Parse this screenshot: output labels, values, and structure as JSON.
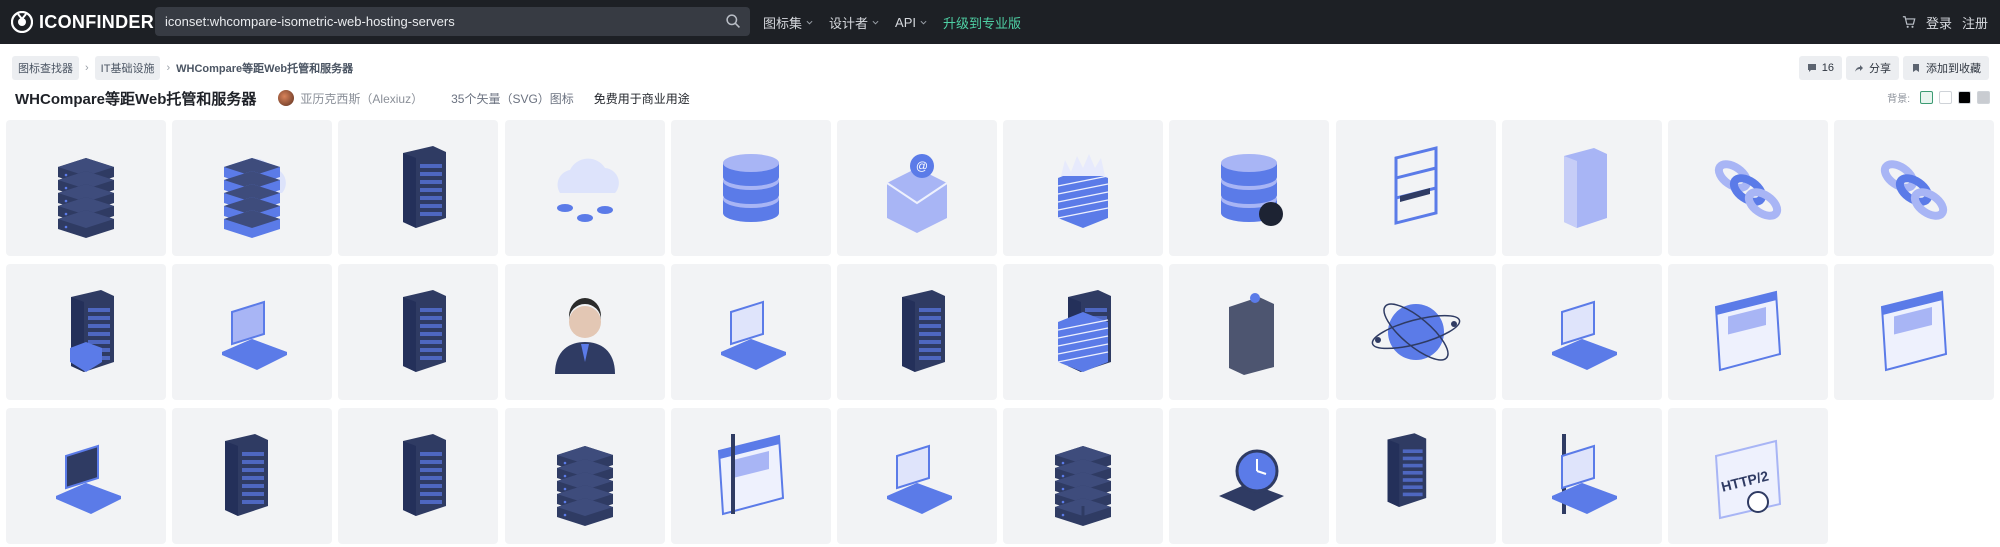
{
  "header": {
    "logo_text": "ICONFINDER",
    "search": {
      "value": "iconset:whcompare-isometric-web-hosting-servers",
      "placeholder": ""
    },
    "nav": [
      {
        "label": "图标集",
        "dropdown": true
      },
      {
        "label": "设计者",
        "dropdown": true
      },
      {
        "label": "API",
        "dropdown": true
      },
      {
        "label": "升级到专业版",
        "dropdown": false
      }
    ],
    "login": "登录",
    "register": "注册"
  },
  "breadcrumb": {
    "items": [
      "图标查找器",
      "IT基础设施"
    ],
    "current": "WHCompare等距Web托管和服务器"
  },
  "actions": {
    "comments_count": "16",
    "share": "分享",
    "add_to_collection": "添加到收藏"
  },
  "iconset": {
    "title": "WHCompare等距Web托管和服务器",
    "author": "亚历克西斯（Alexiuz）",
    "count_text": "35个矢量（SVG）图标",
    "license": "免费用于商业用途"
  },
  "background_picker": {
    "label": "背景:",
    "swatches": [
      "#e8f5ef",
      "#ffffff",
      "#000000",
      "#c9ccd1"
    ]
  },
  "colors": {
    "topbar": "#1d2025",
    "accent": "#4fd1a5",
    "tile": "#f2f3f5",
    "icon_dark": "#2f3b63",
    "icon_mid": "#5b7be8",
    "icon_light": "#a8b5f5"
  },
  "icons": [
    "server-stack-icon",
    "cloud-server-icon",
    "server-tower-icon",
    "cloud-network-icon",
    "database-icon",
    "email-icon",
    "firewall-icon",
    "database-power-icon",
    "server-rack-icon",
    "pc-tower-icon",
    "chain-link-icon",
    "chain-link-2-icon",
    "server-security-icon",
    "laptop-cloud-icon",
    "server-tower-2-icon",
    "support-agent-icon",
    "laptop-code-icon",
    "server-tower-3-icon",
    "server-firewall-icon",
    "server-box-icon",
    "globe-network-icon",
    "laptop-website-icon",
    "web-dashboard-icon",
    "web-browser-icon",
    "laptop-terminal-icon",
    "server-connection-icon",
    "server-tower-4-icon",
    "server-migration-icon",
    "website-construction-icon",
    "laptop-speed-icon",
    "server-network-icon",
    "uptime-clock-icon",
    "server-transfer-icon",
    "crane-code-icon",
    "http2-icon"
  ]
}
